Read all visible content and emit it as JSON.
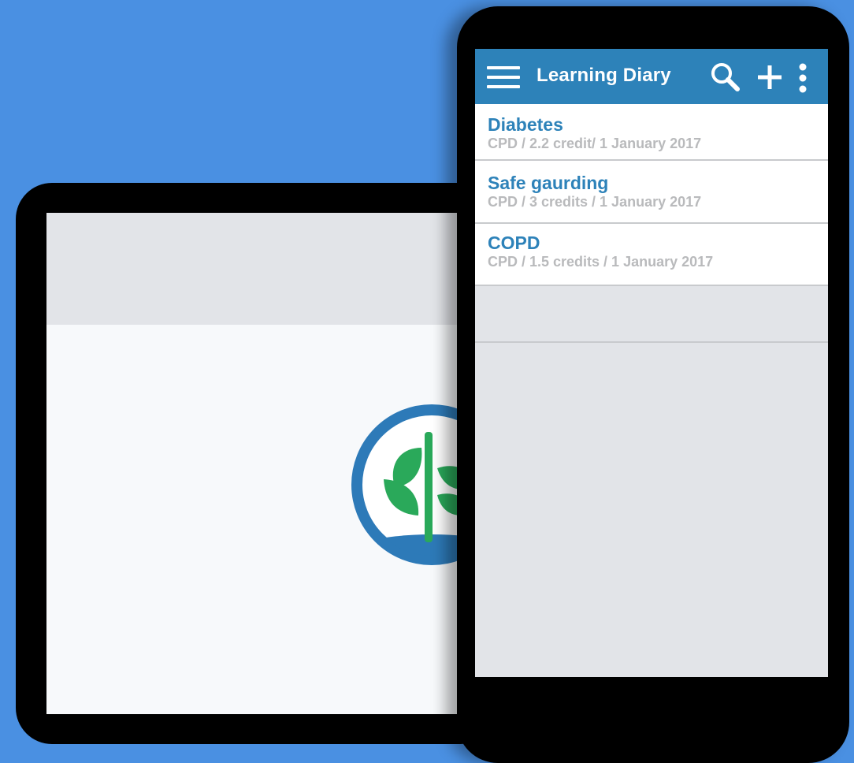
{
  "phone": {
    "appbar": {
      "title": "Learning Diary",
      "icons": [
        "menu-icon",
        "search-icon",
        "add-icon",
        "more-vert-icon"
      ]
    },
    "entries": [
      {
        "title": "Diabetes",
        "meta": "CPD / 2.2 credit/ 1 January 2017"
      },
      {
        "title": "Safe gaurding",
        "meta": "CPD / 3 credits / 1 January 2017"
      },
      {
        "title": "COPD",
        "meta": "CPD / 1.5 credits / 1 January 2017"
      }
    ]
  },
  "tablet": {
    "logo_icon": "plant-logo-icon"
  },
  "colors": {
    "background": "#4a90e2",
    "appbar": "#2d82b9",
    "item_title": "#2d82b9",
    "item_meta": "#b9babc",
    "logo_ring": "#2d7ab8",
    "logo_leaf": "#2aa95a",
    "screen_bg": "#e2e4e8"
  }
}
